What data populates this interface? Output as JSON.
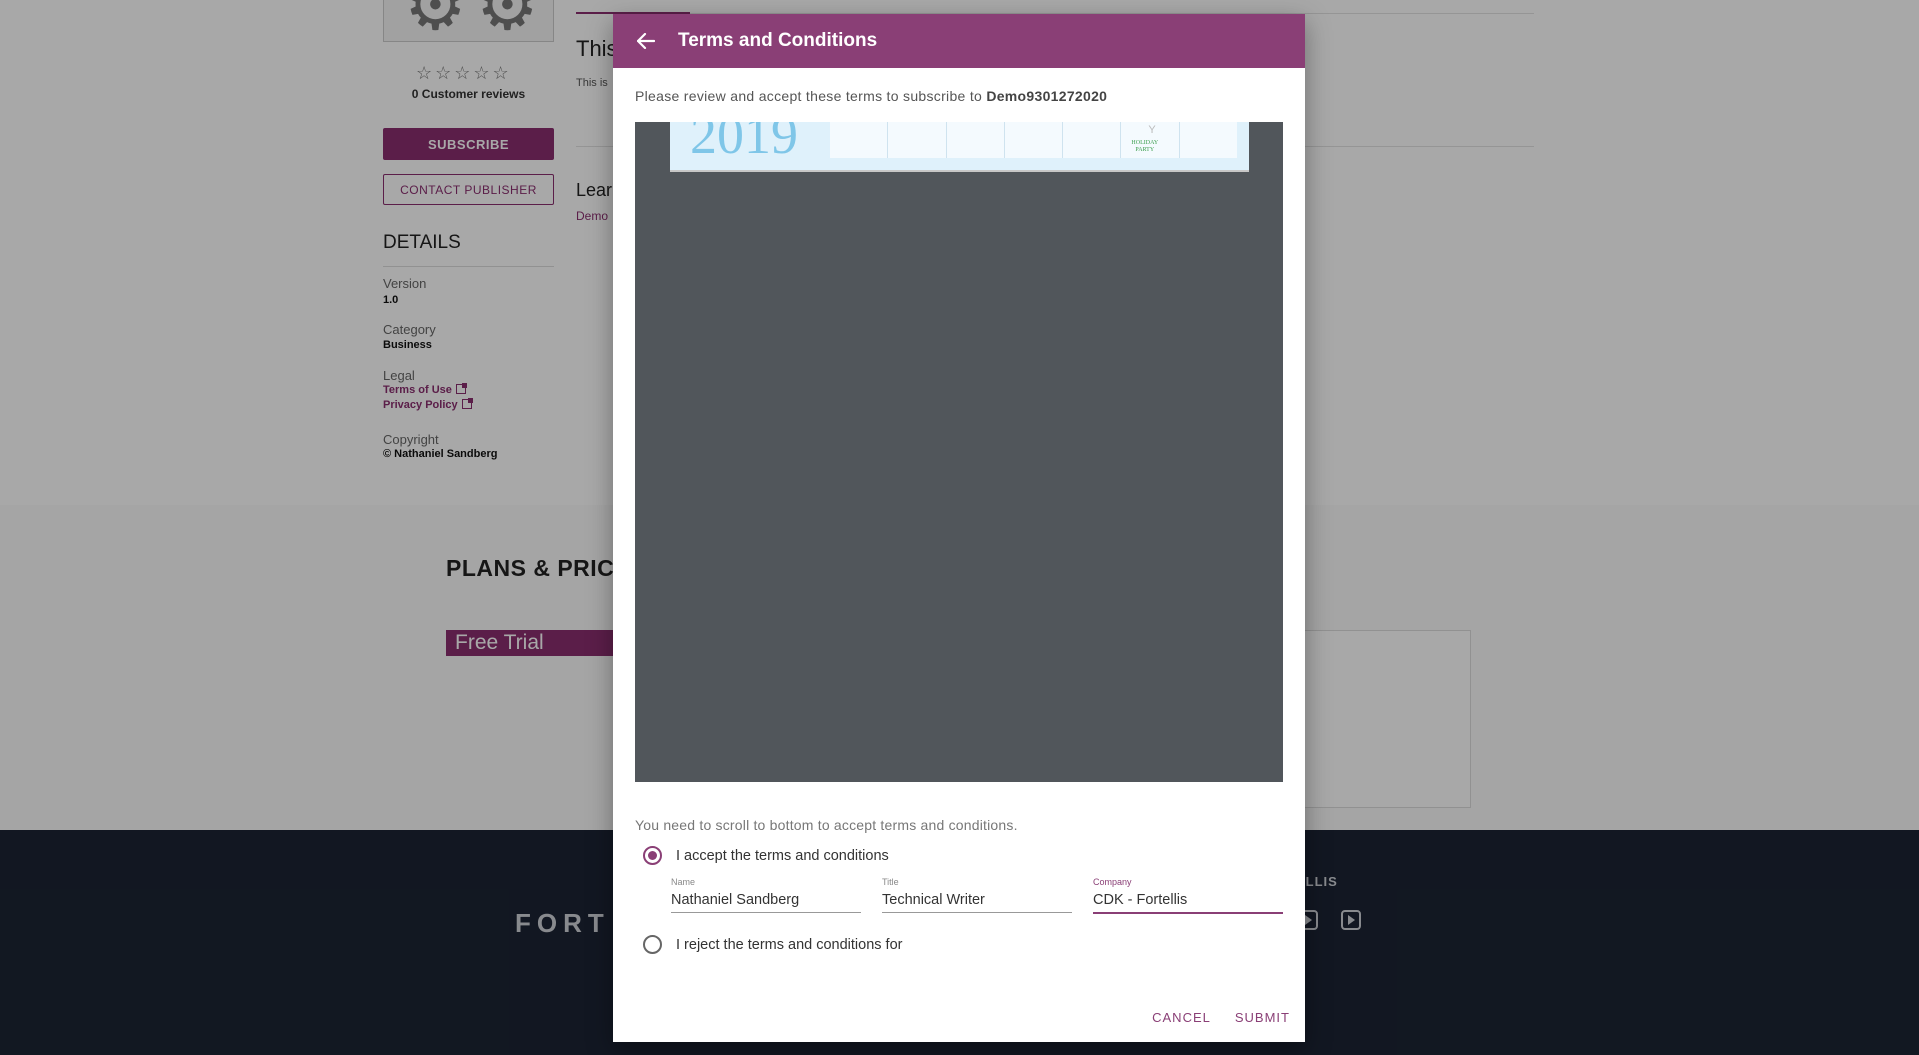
{
  "background_page": {
    "product": {
      "rating_stars": "☆☆☆☆☆",
      "reviews_label": "0 Customer reviews",
      "subscribe_label": "SUBSCRIBE",
      "contact_label": "CONTACT PUBLISHER"
    },
    "details": {
      "title": "DETAILS",
      "version_label": "Version",
      "version_value": "1.0",
      "category_label": "Category",
      "category_value": "Business",
      "legal_label": "Legal",
      "terms_link": "Terms of Use",
      "privacy_link": "Privacy Policy",
      "copyright_label": "Copyright",
      "copyright_value": "© Nathaniel Sandberg"
    },
    "main": {
      "heading_partial": "This",
      "subtext_partial": "This is",
      "learn_partial": "Lear",
      "demo_partial": "Demo"
    },
    "plans": {
      "title_partial": "PLANS & PRIC",
      "free_trial_label": "Free Trial"
    },
    "footer": {
      "logo_partial": "FORT",
      "follow_partial": "ELLIS"
    }
  },
  "modal": {
    "title": "Terms and Conditions",
    "intro_text": "Please review and accept these terms to subscribe to",
    "product_name": "Demo9301272020",
    "document": {
      "year": "2019",
      "holiday_line1": "HOLIDAY",
      "holiday_line2": "PARTY"
    },
    "scroll_hint": "You need to scroll to bottom to accept terms and conditions.",
    "accept_label": "I accept the terms and conditions",
    "reject_label": "I reject the terms and conditions for",
    "selected_option": "accept",
    "fields": {
      "name_label": "Name",
      "name_value": "Nathaniel Sandberg",
      "title_label": "Title",
      "title_value": "Technical Writer",
      "company_label": "Company",
      "company_value": "CDK - Fortellis"
    },
    "cancel_label": "CANCEL",
    "submit_label": "SUBMIT"
  },
  "colors": {
    "brand": "#8a3f76",
    "footer_bg": "#1c2434",
    "viewer_bg": "#51565b"
  }
}
